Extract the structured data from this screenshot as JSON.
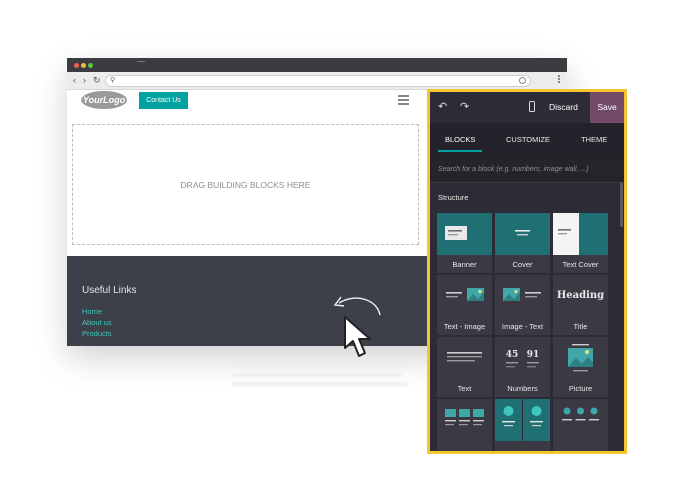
{
  "colors": {
    "panel_frame": "#f5c52f",
    "panel_bg": "#2d2c36",
    "save": "#714b67",
    "teal": "#01a3a0",
    "footer_bg": "#3d4049",
    "footer_link": "#3fc7bd"
  },
  "site": {
    "logo_text": "YourLogo",
    "contact_button": "Contact Us",
    "drop_zone_text": "DRAG BUILDING BLOCKS HERE",
    "footer": {
      "title": "Useful Links",
      "links": [
        "Home",
        "About us",
        "Products"
      ]
    }
  },
  "editor": {
    "discard": "Discard",
    "save": "Save",
    "tabs": [
      {
        "label": "BLOCKS",
        "active": true
      },
      {
        "label": "CUSTOMIZE",
        "active": false
      },
      {
        "label": "THEME",
        "active": false
      }
    ],
    "search_placeholder": "Search for a block (e.g. numbers, image wall, ...)",
    "section": "Structure",
    "blocks": [
      {
        "label": "Banner",
        "icon": "banner-icon"
      },
      {
        "label": "Cover",
        "icon": "cover-icon"
      },
      {
        "label": "Text Cover",
        "icon": "text-cover-icon"
      },
      {
        "label": "Text - Image",
        "icon": "text-image-icon"
      },
      {
        "label": "Image - Text",
        "icon": "image-text-icon"
      },
      {
        "label": "Title",
        "icon": "title-icon",
        "thumb_text": "Heading"
      },
      {
        "label": "Text",
        "icon": "text-icon"
      },
      {
        "label": "Numbers",
        "icon": "numbers-icon",
        "thumb_values": [
          "45",
          "91"
        ]
      },
      {
        "label": "Picture",
        "icon": "picture-icon"
      },
      {
        "label": "",
        "icon": "columns-icon"
      },
      {
        "label": "",
        "icon": "features-icon"
      },
      {
        "label": "",
        "icon": "three-features-icon"
      }
    ]
  }
}
